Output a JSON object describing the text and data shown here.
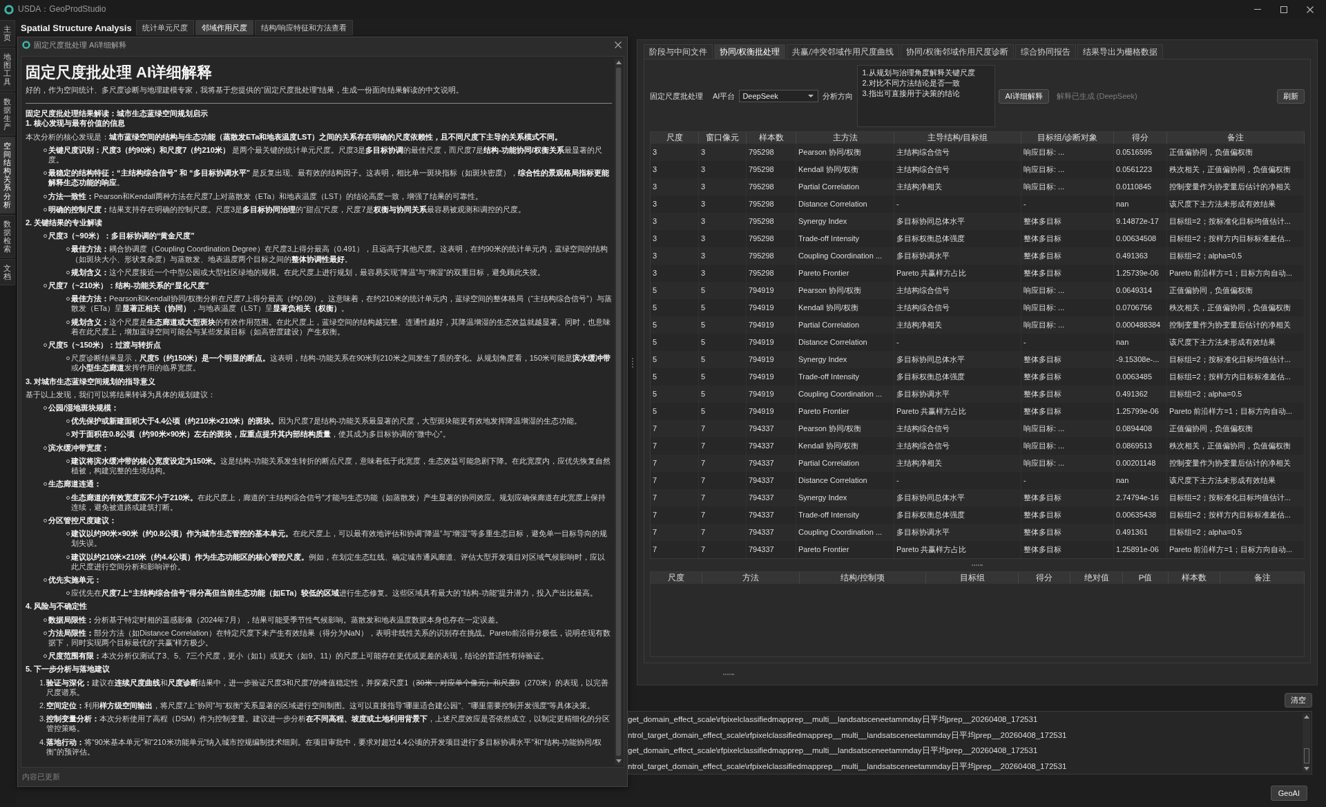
{
  "window": {
    "title": "USDA：GeoProdStudio"
  },
  "side_tabs": [
    {
      "label": "主页",
      "selected": false
    },
    {
      "label": "地图工具",
      "selected": false
    },
    {
      "label": "数据生产",
      "selected": false
    },
    {
      "label": "空间结构关系分析",
      "selected": true
    },
    {
      "label": "数据检索",
      "selected": false
    },
    {
      "label": "文档",
      "selected": false
    }
  ],
  "module": {
    "title": "Spatial Structure Analysis",
    "tabs": [
      {
        "label": "统计单元尺度",
        "selected": false
      },
      {
        "label": "邻域作用尺度",
        "selected": true
      },
      {
        "label": "结构/响应特征和方法查看",
        "selected": false
      }
    ]
  },
  "explanation_dialog": {
    "title": "固定尺度批处理 AI详细解释",
    "heading": "固定尺度批处理 AI详细解释",
    "intro": "好的，作为空间统计、多尺度诊断与地理建模专家，我将基于您提供的“固定尺度批处理”结果，生成一份面向结果解读的中文说明。",
    "blocks": [
      {
        "kind": "title",
        "text": "固定尺度批处理结果解读：城市生态蓝绿空间规划启示"
      },
      {
        "kind": "section",
        "text": "1. 核心发现与最有价值的信息"
      },
      {
        "kind": "para",
        "text": "本次分析的核心发现是：**城市蓝绿空间的结构与生态功能（蒸散发ETa和地表温度LST）之间的关系存在明确的尺度依赖性，且不同尺度下主导的关系模式不同。**"
      },
      {
        "kind": "bullets",
        "items": [
          {
            "text": "**关键尺度识别：尺度3（约90米）和尺度7（约210米）** 是两个最关键的统计单元尺度。尺度3是**多目标协调**的最佳尺度，而尺度7是**结构-功能协同/权衡关系**最显著的尺度。"
          },
          {
            "text": "**最稳定的结构特征：“主结构综合信号” 和 “多目标协调水平”** 是反复出现、最有效的结构因子。这表明，相比单一斑块指标（如斑块密度），**综合性的景观格局指标更能解释生态功能的响应**。"
          },
          {
            "text": "**方法一致性：**Pearson和Kendall两种方法在尺度7上对蒸散发（ETa）和地表温度（LST）的结论高度一致，增强了结果的可靠性。"
          },
          {
            "text": "**明确的控制尺度：**结果支持存在明确的控制尺度。尺度3是**多目标协同治理**的“甜点”尺度，尺度7是**权衡与协同关系**最容易被观测和调控的尺度。"
          }
        ]
      },
      {
        "kind": "section",
        "text": "2. 关键结果的专业解读"
      },
      {
        "kind": "bullets",
        "items": [
          {
            "text": "尺度3（~90米）：多目标协调的“黄金尺度”",
            "children": [
              {
                "text": "**最佳方法：**耦合协调度（Coupling Coordination Degree）在尺度3上得分最高（0.491），且远高于其他尺度。这表明，在约90米的统计单元内，蓝绿空间的结构（如斑块大小、形状复杂度）与蒸散发、地表温度两个目标之间的**整体协调性最好**。"
              },
              {
                "text": "**规划含义：**这个尺度接近一个中型公园或大型社区绿地的规模。在此尺度上进行规划，最容易实现“降温”与“增湿”的双重目标，避免顾此失彼。"
              }
            ]
          },
          {
            "text": "尺度7（~210米）：结构-功能关系的“显化尺度”",
            "children": [
              {
                "text": "**最佳方法：**Pearson和Kendall协同/权衡分析在尺度7上得分最高（约0.09）。这意味着，在约210米的统计单元内，蓝绿空间的整体格局（“主结构综合信号”）与蒸散发（ETa）呈**显著正相关（协同）**，与地表温度（LST）呈**显著负相关（权衡）**。"
              },
              {
                "text": "**规划含义：**这个尺度是**生态廊道或大型斑块**的有效作用范围。在此尺度上，蓝绿空间的结构越完整、连通性越好，其降温增湿的生态效益就越显著。同时，也意味着在此尺度上，增加蓝绿空间可能会与某些发展目标（如高密度建设）产生权衡。"
              }
            ]
          },
          {
            "text": "尺度5（~150米）：过渡与转折点",
            "children": [
              {
                "text": "尺度诊断结果显示，**尺度5（约150米）是一个明显的断点。**这表明，结构-功能关系在90米到210米之间发生了质的变化。从规划角度看，150米可能是**滨水缓冲带**或**小型生态廊道**发挥作用的临界宽度。"
              }
            ]
          }
        ]
      },
      {
        "kind": "section",
        "text": "3. 对城市生态蓝绿空间规划的指导意义"
      },
      {
        "kind": "para",
        "text": "基于以上发现，我们可以将结果转译为具体的规划建议："
      },
      {
        "kind": "bullets",
        "items": [
          {
            "text": "公园/湿地斑块规模：",
            "children": [
              {
                "text": "**优先保护或新建面积大于4.4公顷（约210米×210米）的斑块。**因为尺度7是结构-功能关系最显著的尺度，大型斑块能更有效地发挥降温增湿的生态功能。"
              },
              {
                "text": "**对于面积在0.8公顷（约90米×90米）左右的斑块，应重点提升其内部结构质量**，使其成为多目标协调的“微中心”。"
              }
            ]
          },
          {
            "text": "滨水缓冲带宽度：",
            "children": [
              {
                "text": "**建议将滨水缓冲带的核心宽度设定为150米。**这是结构-功能关系发生转折的断点尺度，意味着低于此宽度，生态效益可能急剧下降。在此宽度内，应优先恢复自然植被，构建完整的生境结构。"
              }
            ]
          },
          {
            "text": "生态廊道连通：",
            "children": [
              {
                "text": "**生态廊道的有效宽度应不小于210米。**在此尺度上，廊道的“主结构综合信号”才能与生态功能（如蒸散发）产生显著的协同效应。规划应确保廊道在此宽度上保持连续，避免被道路或建筑打断。"
              }
            ]
          },
          {
            "text": "分区管控尺度建议：",
            "children": [
              {
                "text": "**建议以约90米×90米（约0.8公顷）作为城市生态管控的基本单元。**在此尺度上，可以最有效地评估和协调“降温”与“增湿”等多重生态目标，避免单一目标导向的规划失误。"
              },
              {
                "text": "**建议以约210米×210米（约4.4公顷）作为生态功能区的核心管控尺度。**例如，在划定生态红线、确定城市通风廊道、评估大型开发项目对区域气候影响时，应以此尺度进行空间分析和影响评价。"
              }
            ]
          },
          {
            "text": "优先实施单元：",
            "children": [
              {
                "text": "应优先在**尺度7上“主结构综合信号”得分高但当前生态功能（如ETa）较低的区域**进行生态修复。这些区域具有最大的“结构-功能”提升潜力，投入产出比最高。"
              }
            ]
          }
        ]
      },
      {
        "kind": "section",
        "text": "4. 风险与不确定性"
      },
      {
        "kind": "bullets",
        "items": [
          {
            "text": "**数据局限性：**分析基于特定时相的遥感影像（2024年7月），结果可能受季节性气候影响。蒸散发和地表温度数据本身也存在一定误差。"
          },
          {
            "text": "**方法局限性：**部分方法（如Distance Correlation）在特定尺度下未产生有效结果（得分为NaN），表明非线性关系的识别存在挑战。Pareto前沿得分极低，说明在现有数据下，同时实现两个目标最优的“共赢”样方极少。"
          },
          {
            "text": "**尺度范围有限：**本次分析仅测试了3、5、7三个尺度，更小（如1）或更大（如9、11）的尺度上可能存在更优或更差的表现，结论的普适性有待验证。"
          }
        ]
      },
      {
        "kind": "section",
        "text": "5. 下一步分析与落地建议"
      },
      {
        "kind": "numbered",
        "items": [
          {
            "number": "1.",
            "parts": [
              {
                "text": "**验证与深化：**建议在**连续尺度曲线**和**尺度诊断**结果中，进一步验证尺度3和尺度7的峰值稳定性，并探索尺度1（",
                "struck": false
              },
              {
                "text": "30米，对应单个像元）和尺度9",
                "struck": true
              },
              {
                "text": "（270米）的表现，以完善尺度谱系。",
                "struck": false
              }
            ]
          },
          {
            "number": "2.",
            "text": "**空间定位：**利用**样方级空间输出**，将尺度7上“协同”与“权衡”关系显著的区域进行空间制图。这可以直接指导“哪里适合建公园”、“哪里需要控制开发强度”等具体决策。"
          },
          {
            "number": "3.",
            "text": "**控制变量分析：**本次分析使用了高程（DSM）作为控制变量。建议进一步分析**在不同高程、坡度或土地利用背景下**，上述尺度效应是否依然成立，以制定更精细化的分区管控策略。"
          },
          {
            "number": "4.",
            "text": "**落地行动：**将“90米基本单元”和“210米功能单元”纳入城市控规编制技术细则。在项目审批中，要求对超过4.4公顷的开发项目进行“多目标协调水平”和“结构-功能协同/权衡”的预评估。"
          }
        ]
      }
    ],
    "status": "内容已更新"
  },
  "batch_panel": {
    "tabs": [
      {
        "label": "阶段与中间文件",
        "selected": false
      },
      {
        "label": "协同/权衡批处理",
        "selected": true
      },
      {
        "label": "共赢/冲突邻域作用尺度曲线",
        "selected": false
      },
      {
        "label": "协同/权衡邻域作用尺度诊断",
        "selected": false
      },
      {
        "label": "综合协同报告",
        "selected": false
      },
      {
        "label": "结果导出为栅格数据",
        "selected": false
      }
    ],
    "toolbar": {
      "group_label": "固定尺度批处理",
      "platform_label": "AI平台",
      "platform": "DeepSeek",
      "direction_label": "分析方向",
      "direction": "1.从规划与治理角度解释关键尺度\n2.对比不同方法结论是否一致\n3.指出可直接用于决策的结论",
      "explain_button": "AI详细解释",
      "status": "解释已生成 (DeepSeek)",
      "refresh_button": "刷新"
    },
    "results_table": {
      "columns": [
        "尺度",
        "窗口像元",
        "样本数",
        "主方法",
        "主导结构/目标组",
        "目标组/诊断对象",
        "得分",
        "备注"
      ],
      "rows": [
        [
          "3",
          "3",
          "795298",
          "Pearson 协同/权衡",
          "主结构综合信号",
          "响应目标: ...",
          "0.0516595",
          "正值偏协同，负值偏权衡"
        ],
        [
          "3",
          "3",
          "795298",
          "Kendall 协同/权衡",
          "主结构综合信号",
          "响应目标: ...",
          "0.0561223",
          "秩次相关，正值偏协同，负值偏权衡"
        ],
        [
          "3",
          "3",
          "795298",
          "Partial Correlation",
          "主结构净相关",
          "响应目标: ...",
          "0.0110845",
          "控制变量作为协变量后估计的净相关"
        ],
        [
          "3",
          "3",
          "795298",
          "Distance Correlation",
          "-",
          "-",
          "nan",
          "该尺度下主方法未形成有效结果"
        ],
        [
          "3",
          "3",
          "795298",
          "Synergy Index",
          "多目标协同总体水平",
          "整体多目标",
          "9.14872e-17",
          "目标组=2；按标准化目标均值估计..."
        ],
        [
          "3",
          "3",
          "795298",
          "Trade-off Intensity",
          "多目标权衡总体强度",
          "整体多目标",
          "0.00634508",
          "目标组=2；按样方内目标标准差估..."
        ],
        [
          "3",
          "3",
          "795298",
          "Coupling Coordination ...",
          "多目标协调水平",
          "整体多目标",
          "0.491363",
          "目标组=2；alpha=0.5"
        ],
        [
          "3",
          "3",
          "795298",
          "Pareto Frontier",
          "Pareto 共赢样方占比",
          "整体多目标",
          "1.25739e-06",
          "Pareto 前沿样方=1；目标方向自动..."
        ],
        [
          "5",
          "5",
          "794919",
          "Pearson 协同/权衡",
          "主结构综合信号",
          "响应目标: ...",
          "0.0649314",
          "正值偏协同，负值偏权衡"
        ],
        [
          "5",
          "5",
          "794919",
          "Kendall 协同/权衡",
          "主结构综合信号",
          "响应目标: ...",
          "0.0706756",
          "秩次相关，正值偏协同，负值偏权衡"
        ],
        [
          "5",
          "5",
          "794919",
          "Partial Correlation",
          "主结构净相关",
          "响应目标: ...",
          "0.000488384",
          "控制变量作为协变量后估计的净相关"
        ],
        [
          "5",
          "5",
          "794919",
          "Distance Correlation",
          "-",
          "-",
          "nan",
          "该尺度下主方法未形成有效结果"
        ],
        [
          "5",
          "5",
          "794919",
          "Synergy Index",
          "多目标协同总体水平",
          "整体多目标",
          "-9.15308e-...",
          "目标组=2；按标准化目标均值估计..."
        ],
        [
          "5",
          "5",
          "794919",
          "Trade-off Intensity",
          "多目标权衡总体强度",
          "整体多目标",
          "0.0063485",
          "目标组=2；按样方内目标标准差估..."
        ],
        [
          "5",
          "5",
          "794919",
          "Coupling Coordination ...",
          "多目标协调水平",
          "整体多目标",
          "0.491362",
          "目标组=2；alpha=0.5"
        ],
        [
          "5",
          "5",
          "794919",
          "Pareto Frontier",
          "Pareto 共赢样方占比",
          "整体多目标",
          "1.25799e-06",
          "Pareto 前沿样方=1；目标方向自动..."
        ],
        [
          "7",
          "7",
          "794337",
          "Pearson 协同/权衡",
          "主结构综合信号",
          "响应目标: ...",
          "0.0894408",
          "正值偏协同，负值偏权衡"
        ],
        [
          "7",
          "7",
          "794337",
          "Kendall 协同/权衡",
          "主结构综合信号",
          "响应目标: ...",
          "0.0869513",
          "秩次相关，正值偏协同，负值偏权衡"
        ],
        [
          "7",
          "7",
          "794337",
          "Partial Correlation",
          "主结构净相关",
          "响应目标: ...",
          "0.00201148",
          "控制变量作为协变量后估计的净相关"
        ],
        [
          "7",
          "7",
          "794337",
          "Distance Correlation",
          "-",
          "-",
          "nan",
          "该尺度下主方法未形成有效结果"
        ],
        [
          "7",
          "7",
          "794337",
          "Synergy Index",
          "多目标协同总体水平",
          "整体多目标",
          "2.74794e-16",
          "目标组=2；按标准化目标均值估计..."
        ],
        [
          "7",
          "7",
          "794337",
          "Trade-off Intensity",
          "多目标权衡总体强度",
          "整体多目标",
          "0.00635438",
          "目标组=2；按样方内目标标准差估..."
        ],
        [
          "7",
          "7",
          "794337",
          "Coupling Coordination ...",
          "多目标协调水平",
          "整体多目标",
          "0.491361",
          "目标组=2；alpha=0.5"
        ],
        [
          "7",
          "7",
          "794337",
          "Pareto Frontier",
          "Pareto 共赢样方占比",
          "整体多目标",
          "1.25891e-06",
          "Pareto 前沿样方=1；目标方向自动..."
        ]
      ]
    },
    "detail_table": {
      "columns": [
        "尺度",
        "方法",
        "结构/控制项",
        "目标组",
        "得分",
        "绝对值",
        "P值",
        "样本数",
        "备注"
      ]
    }
  },
  "log": {
    "clear_button": "清空",
    "lines": [
      "get_domain_effect_scale\\rfpixelclassifiedmapprep__multi__landsatsceneetammday日平均prep__20260408_172531",
      "ntrol_target_domain_effect_scale\\rfpixelclassifiedmapprep__multi__landsatsceneetammday日平均prep__20260408_172531",
      "get_domain_effect_scale\\rfpixelclassifiedmapprep__multi__landsatsceneetammday日平均prep__20260408_172531",
      "ntrol_target_domain_effect_scale\\rfpixelclassifiedmapprep__multi__landsatsceneetammday日平均prep__20260408_172531"
    ]
  },
  "footer": {
    "button": "GeoAI"
  }
}
